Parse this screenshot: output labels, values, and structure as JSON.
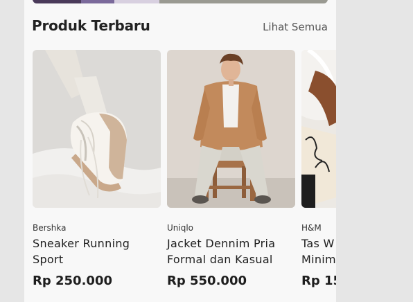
{
  "section": {
    "title": "Produk Terbaru",
    "see_all": "Lihat Semua"
  },
  "products": [
    {
      "brand": "Bershka",
      "name": "Sneaker Running Sport",
      "price": "Rp 250.000",
      "image": "sneaker-photo"
    },
    {
      "brand": "Uniqlo",
      "name": "Jacket Dennim Pria Formal dan Kasual",
      "price": "Rp 550.000",
      "image": "jacket-photo"
    },
    {
      "brand": "H&M",
      "name": "Tas W\nMinim",
      "price": "Rp 15",
      "image": "bag-photo"
    }
  ]
}
